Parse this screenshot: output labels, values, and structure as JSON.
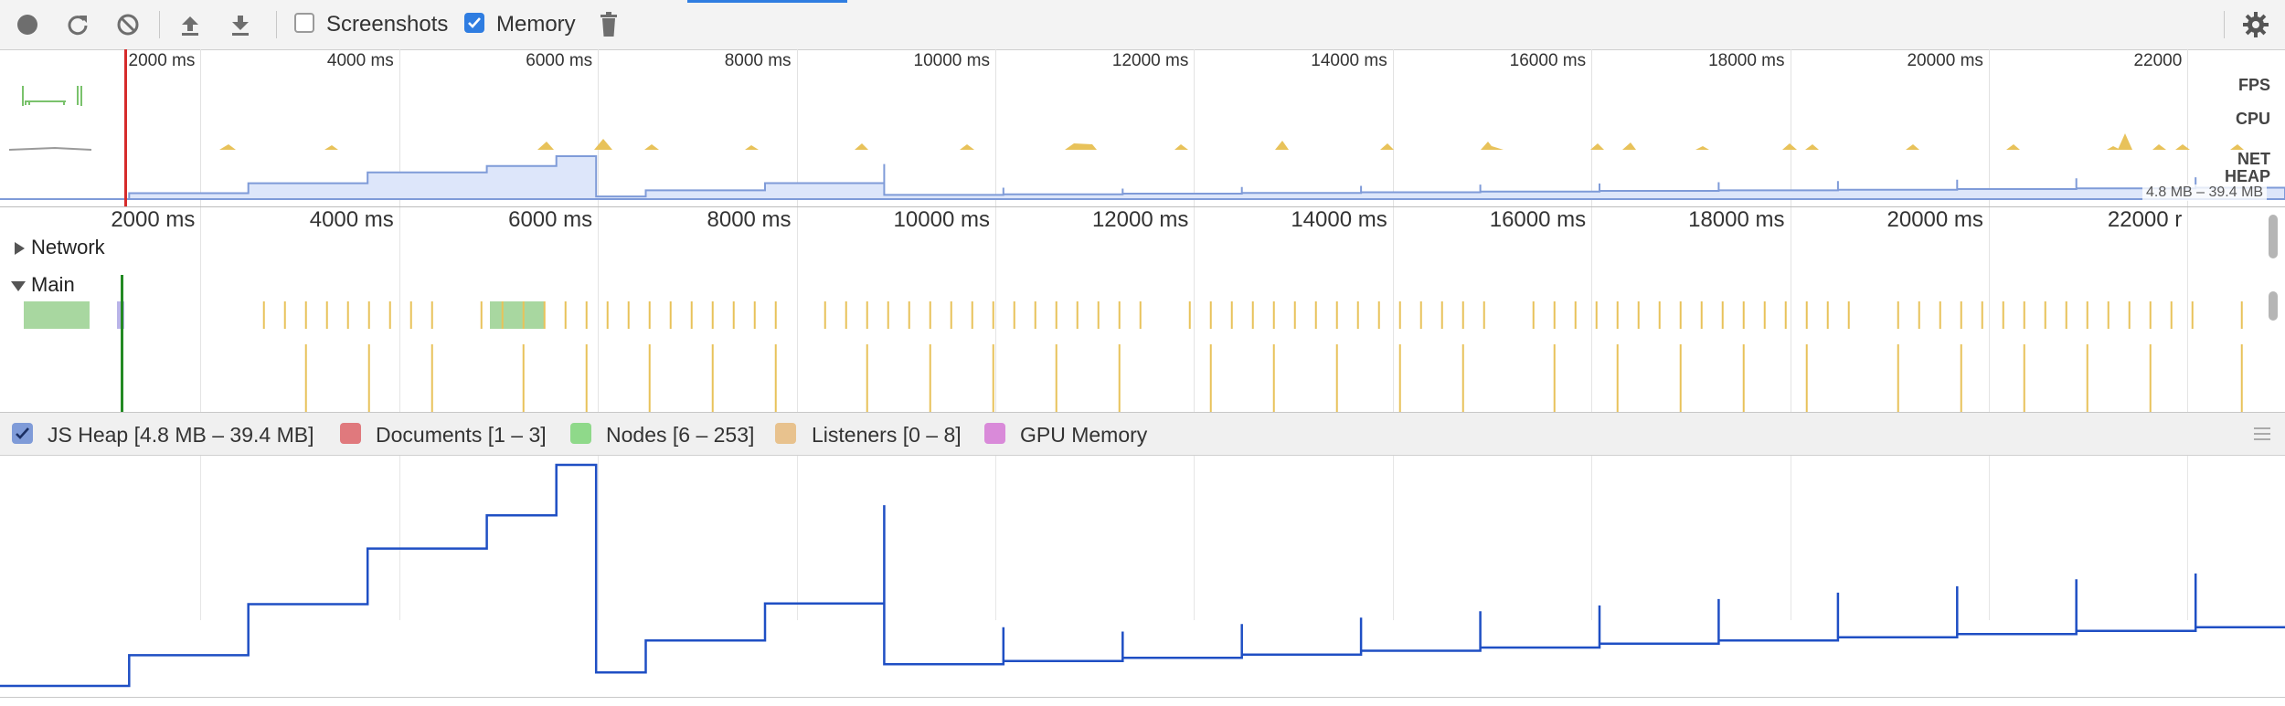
{
  "toolbar": {
    "screenshots_label": "Screenshots",
    "screenshots_checked": false,
    "memory_label": "Memory",
    "memory_checked": true
  },
  "overview": {
    "tick_labels": [
      "2000 ms",
      "4000 ms",
      "6000 ms",
      "8000 ms",
      "10000 ms",
      "12000 ms",
      "14000 ms",
      "16000 ms",
      "18000 ms",
      "20000 ms",
      "22000"
    ],
    "track_labels": {
      "fps": "FPS",
      "cpu": "CPU",
      "net": "NET",
      "heap": "HEAP"
    },
    "heap_range": "4.8 MB – 39.4 MB"
  },
  "flamechart": {
    "tick_labels": [
      "2000 ms",
      "4000 ms",
      "6000 ms",
      "8000 ms",
      "10000 ms",
      "12000 ms",
      "14000 ms",
      "16000 ms",
      "18000 ms",
      "20000 ms",
      "22000 r"
    ],
    "network_label": "Network",
    "main_label": "Main"
  },
  "legend": {
    "items": [
      {
        "label": "JS Heap [4.8 MB – 39.4 MB]",
        "color": "#7f9bd8",
        "checked": true
      },
      {
        "label": "Documents [1 – 3]",
        "color": "#e0797d",
        "checked": false
      },
      {
        "label": "Nodes [6 – 253]",
        "color": "#8fd98a",
        "checked": false
      },
      {
        "label": "Listeners [0 – 8]",
        "color": "#e8c28e",
        "checked": false
      },
      {
        "label": "GPU Memory",
        "color": "#d98ad9",
        "checked": false
      }
    ]
  },
  "colors": {
    "accent": "#2f7de1",
    "heap_line": "#1f4fc4",
    "heap_fill": "#dde6fa",
    "cpu_scripting": "#e8c25a",
    "fps_green": "#7ac26c",
    "playhead": "#d62b2b"
  },
  "icons": [
    "record-icon",
    "reload-icon",
    "clear-icon",
    "upload-icon",
    "download-icon",
    "trash-icon",
    "gear-icon"
  ],
  "chart_data": {
    "type": "line",
    "series": [
      {
        "name": "JS Heap",
        "unit": "ms / MB",
        "points": [
          [
            0,
            4.8
          ],
          [
            1300,
            4.8
          ],
          [
            1300,
            9.6
          ],
          [
            2500,
            9.6
          ],
          [
            2500,
            17.6
          ],
          [
            3700,
            17.6
          ],
          [
            3700,
            26.3
          ],
          [
            4900,
            26.3
          ],
          [
            4900,
            31.5
          ],
          [
            5600,
            31.5
          ],
          [
            5600,
            39.4
          ],
          [
            6000,
            39.4
          ],
          [
            6000,
            6.9
          ],
          [
            6500,
            6.9
          ],
          [
            6500,
            11.9
          ],
          [
            7700,
            11.9
          ],
          [
            7700,
            17.7
          ],
          [
            8900,
            17.7
          ],
          [
            8900,
            23.6
          ],
          [
            8900,
            33.1
          ],
          [
            8900,
            8.2
          ],
          [
            10100,
            8.2
          ],
          [
            10100,
            14.0
          ],
          [
            10100,
            8.7
          ],
          [
            11300,
            8.7
          ],
          [
            11300,
            13.3
          ],
          [
            11300,
            9.2
          ],
          [
            12500,
            9.2
          ],
          [
            12500,
            14.5
          ],
          [
            12500,
            9.7
          ],
          [
            13700,
            9.7
          ],
          [
            13700,
            15.5
          ],
          [
            13700,
            10.3
          ],
          [
            14900,
            10.3
          ],
          [
            14900,
            16.5
          ],
          [
            14900,
            10.8
          ],
          [
            16100,
            10.8
          ],
          [
            16100,
            17.4
          ],
          [
            16100,
            11.4
          ],
          [
            17300,
            11.4
          ],
          [
            17300,
            18.4
          ],
          [
            17300,
            11.9
          ],
          [
            18500,
            11.9
          ],
          [
            18500,
            19.4
          ],
          [
            18500,
            12.4
          ],
          [
            19700,
            12.4
          ],
          [
            19700,
            20.4
          ],
          [
            19700,
            12.9
          ],
          [
            20900,
            12.9
          ],
          [
            20900,
            21.5
          ],
          [
            20900,
            13.4
          ],
          [
            22100,
            13.4
          ],
          [
            22100,
            22.4
          ],
          [
            22100,
            14.0
          ],
          [
            23000,
            14.0
          ]
        ]
      }
    ],
    "x_range": [
      0,
      23000
    ],
    "y_range": [
      4.8,
      39.4
    ]
  }
}
